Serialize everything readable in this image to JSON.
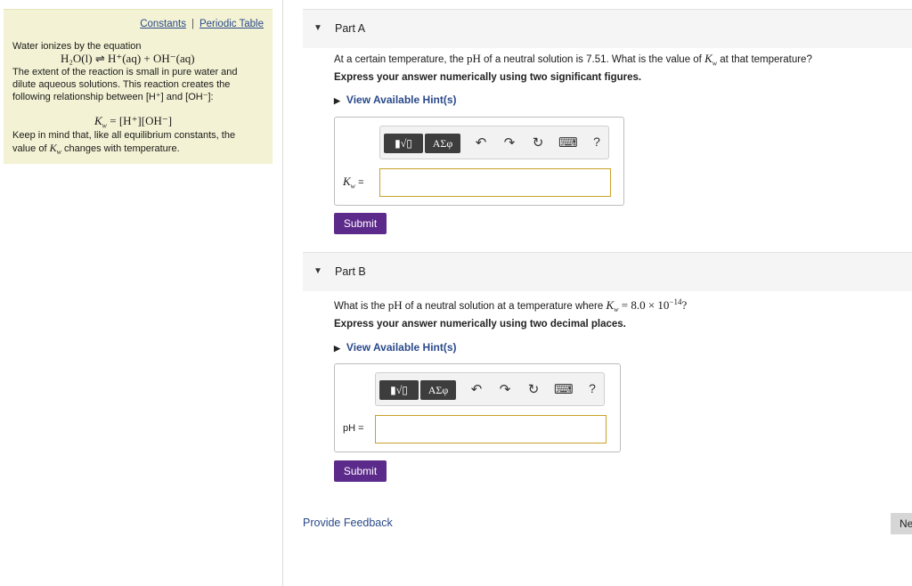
{
  "left_panel": {
    "links": [
      "Constants",
      "Periodic Table"
    ],
    "separator": "|",
    "intro": "Water ionizes by the equation",
    "equation": "H₂O(l) ⇌ H⁺(aq) + OH⁻(aq)",
    "para1_l1": "The extent of the reaction is small in pure water and",
    "para1_l2": "dilute aqueous solutions. This reaction creates the",
    "para1_l3": "following relationship between [H⁺] and [OH⁻]:",
    "kw_equation": "K",
    "kw_sub": "w",
    "kw_rhs": " = [H⁺][OH⁻]",
    "para2_l1": "Keep in mind that, like all equilibrium constants, the",
    "para2_l2a": "value of ",
    "para2_l2b": " changes with temperature."
  },
  "part_a": {
    "title": "Part A",
    "question_pre": "At a certain temperature, the ",
    "ph": "pH",
    "question_mid": " of a neutral solution is 7.51. What is the value of ",
    "question_post": " at that temperature?",
    "instruction": "Express your answer numerically using two significant figures.",
    "hint": "View Available Hint(s)",
    "answer_label_post": " =",
    "answer_value": "",
    "submit": "Submit"
  },
  "part_b": {
    "title": "Part B",
    "question_pre": "What is the ",
    "ph": "pH",
    "question_mid": " of a neutral solution at a temperature where ",
    "question_val": " = 8.0 × 10",
    "question_exp": "−14",
    "question_post": "?",
    "instruction": "Express your answer numerically using two decimal places.",
    "hint": "View Available Hint(s)",
    "answer_label": "pH =",
    "answer_value": "",
    "submit": "Submit"
  },
  "toolbar": {
    "template_label": "▮√▯",
    "greek_label": "ΑΣφ",
    "undo": "↶",
    "redo": "↷",
    "reset": "↻",
    "keyboard": "⌨",
    "help": "?"
  },
  "footer": {
    "feedback": "Provide Feedback",
    "next": "Ne"
  }
}
